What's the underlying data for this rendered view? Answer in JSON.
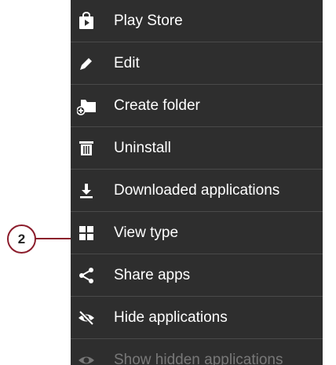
{
  "colors": {
    "menu_bg": "#2e2e2e",
    "divider": "#4a4a4a",
    "text": "#ffffff",
    "callout": "#8b1c2b"
  },
  "callout": {
    "number": "2"
  },
  "menu": {
    "items": [
      {
        "label": "Play Store",
        "icon": "play-store-icon"
      },
      {
        "label": "Edit",
        "icon": "pencil-icon"
      },
      {
        "label": "Create folder",
        "icon": "create-folder-icon"
      },
      {
        "label": "Uninstall",
        "icon": "trash-icon"
      },
      {
        "label": "Downloaded applications",
        "icon": "download-icon"
      },
      {
        "label": "View type",
        "icon": "grid-icon"
      },
      {
        "label": "Share apps",
        "icon": "share-icon"
      },
      {
        "label": "Hide applications",
        "icon": "eye-slash-icon"
      },
      {
        "label": "Show hidden applications",
        "icon": "eye-icon"
      }
    ]
  }
}
